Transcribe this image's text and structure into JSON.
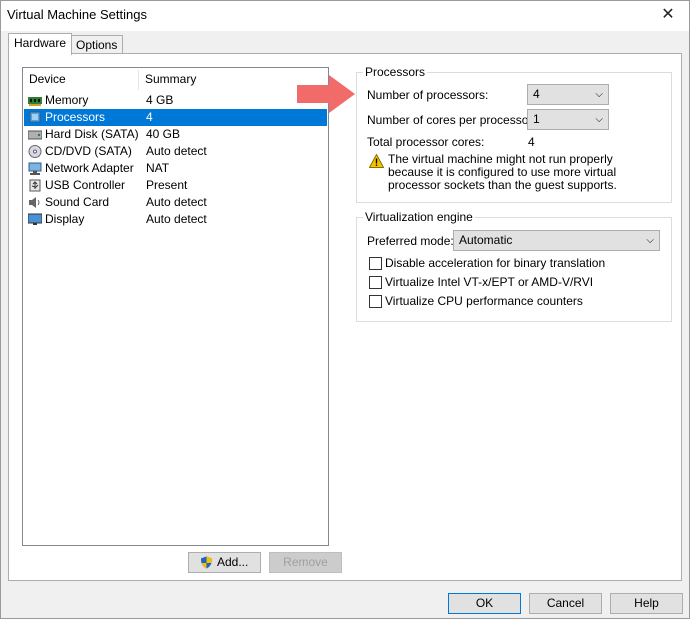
{
  "window": {
    "title": "Virtual Machine Settings"
  },
  "tabs": [
    {
      "label": "Hardware",
      "active": true
    },
    {
      "label": "Options",
      "active": false
    }
  ],
  "device_list": {
    "columns": [
      "Device",
      "Summary"
    ],
    "rows": [
      {
        "device": "Memory",
        "summary": "4 GB",
        "icon": "memory-icon",
        "selected": false
      },
      {
        "device": "Processors",
        "summary": "4",
        "icon": "processor-icon",
        "selected": true
      },
      {
        "device": "Hard Disk (SATA)",
        "summary": "40 GB",
        "icon": "hard-disk-icon",
        "selected": false
      },
      {
        "device": "CD/DVD (SATA)",
        "summary": "Auto detect",
        "icon": "cd-dvd-icon",
        "selected": false
      },
      {
        "device": "Network Adapter",
        "summary": "NAT",
        "icon": "network-adapter-icon",
        "selected": false
      },
      {
        "device": "USB Controller",
        "summary": "Present",
        "icon": "usb-icon",
        "selected": false
      },
      {
        "device": "Sound Card",
        "summary": "Auto detect",
        "icon": "speaker-icon",
        "selected": false
      },
      {
        "device": "Display",
        "summary": "Auto detect",
        "icon": "monitor-icon",
        "selected": false
      }
    ]
  },
  "list_buttons": {
    "add": "Add...",
    "remove": "Remove"
  },
  "processors": {
    "group_label": "Processors",
    "num_processors_label": "Number of processors:",
    "num_processors_value": "4",
    "cores_label": "Number of cores per processor:",
    "cores_value": "1",
    "total_label": "Total processor cores:",
    "total_value": "4",
    "warning": "The virtual machine might not run properly because it is configured to use more virtual processor sockets than the guest supports."
  },
  "virtualization": {
    "group_label": "Virtualization engine",
    "preferred_mode_label": "Preferred mode:",
    "preferred_mode_value": "Automatic",
    "options": [
      {
        "label": "Disable acceleration for binary translation",
        "checked": false
      },
      {
        "label": "Virtualize Intel VT-x/EPT or AMD-V/RVI",
        "checked": false
      },
      {
        "label": "Virtualize CPU performance counters",
        "checked": false
      }
    ]
  },
  "dialog_buttons": {
    "ok": "OK",
    "cancel": "Cancel",
    "help": "Help"
  },
  "colors": {
    "selection": "#0078d7",
    "arrow": "#f26b6b",
    "warning": "#f5c400"
  }
}
